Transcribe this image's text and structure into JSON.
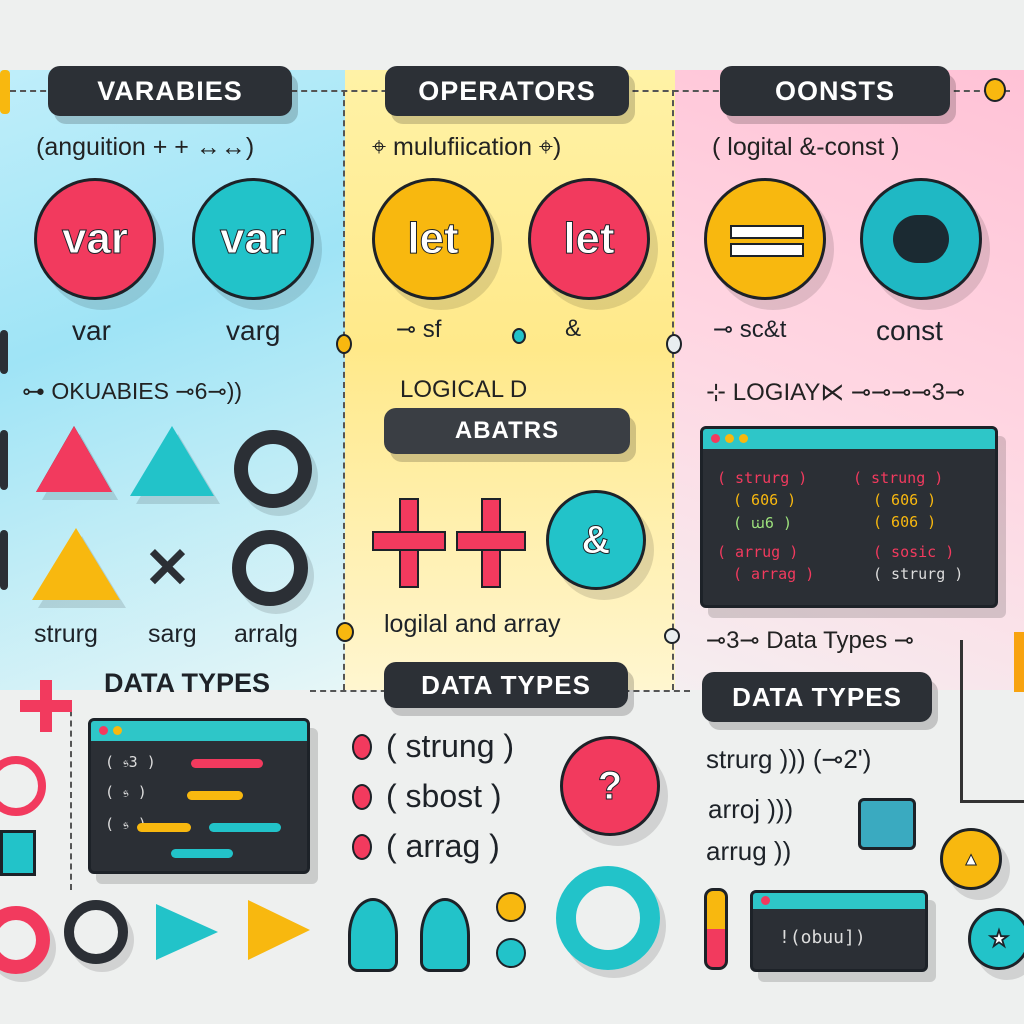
{
  "columns": [
    {
      "title": "VARABIES",
      "subtitle": "(anguition +  +  ↔↔)"
    },
    {
      "title": "OPERATORS",
      "subtitle": "⌖ mulufiication  ⌖)"
    },
    {
      "title": "OONSTS",
      "subtitle": "( logital  &-const )"
    }
  ],
  "keyword_circles": [
    {
      "label": "var",
      "color": "#f23a5e"
    },
    {
      "label": "var",
      "color": "#22c3c9"
    },
    {
      "label": "let",
      "color": "#f8b80f"
    },
    {
      "label": "let",
      "color": "#f23a5e"
    }
  ],
  "circle_captions": [
    "var",
    "varg",
    "⊸ sf",
    "&",
    "⊸ sc&t",
    "const"
  ],
  "section_labels": {
    "left": "⊶ OKUABIES  ⊸6⊸))",
    "middle": "LOGICAL      D",
    "right": "⊹ LOGIAY⋉  ⊸⊸⊸⊸3⊸"
  },
  "middle_pill": "ABATRS",
  "shape_captions": [
    "strurg",
    "sarg",
    "arralg"
  ],
  "logical_caption": "logilal  and   array",
  "data_types": {
    "left": "DATA TYPES",
    "center": "DATA TYPES",
    "right": "DATA TYPES",
    "small": "⊸3⊸ Data Types ⊸"
  },
  "type_list": [
    "( strung )",
    "( sbost )",
    "( arrag )"
  ],
  "question_mark": "?",
  "ampersand": "&",
  "right_terminal_code": [
    [
      "( strurg )",
      "( strung )"
    ],
    [
      "( 606 )",
      "( 606 )"
    ],
    [
      "( ꭐ6 )",
      "( 606 )"
    ],
    [
      "( arrug )",
      "( sosic )"
    ],
    [
      "( arrag )",
      "( strurg )"
    ]
  ],
  "left_terminal_code": [
    "( 𝔰3 )",
    "( 𝔰 )",
    "( 𝔰 )"
  ],
  "right_type_list": [
    "strurg )))  (⊸2')",
    "arroj )))",
    "arrug ))"
  ],
  "bottom_terminal": "!(obuu])",
  "stray_marks": [
    "𝓈",
    "ꓘ"
  ]
}
